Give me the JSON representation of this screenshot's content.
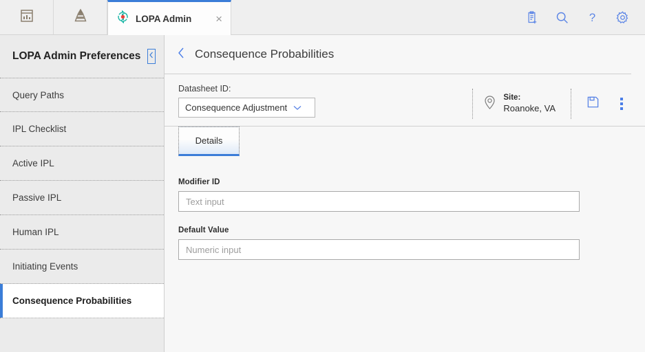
{
  "tabstrip": {
    "icon_tabs": [
      {
        "name": "dashboard-icon",
        "label": "Dashboard"
      },
      {
        "name": "pyramid-icon",
        "label": "Hierarchy"
      }
    ],
    "app_tab": {
      "label": "LOPA Admin",
      "icon": "refresh-circle-icon",
      "close_label": "×"
    },
    "actions": [
      {
        "name": "clipboard-add-icon",
        "label": "New Record"
      },
      {
        "name": "search-icon",
        "label": "Search"
      },
      {
        "name": "help-icon",
        "label": "Help"
      },
      {
        "name": "gear-icon",
        "label": "Settings"
      }
    ]
  },
  "sidebar": {
    "title": "LOPA Admin Preferences",
    "collapse_icon": "chevron-left-icon",
    "items": [
      {
        "label": "Query Paths",
        "active": false
      },
      {
        "label": "IPL Checklist",
        "active": false
      },
      {
        "label": "Active IPL",
        "active": false
      },
      {
        "label": "Passive IPL",
        "active": false
      },
      {
        "label": "Human IPL",
        "active": false
      },
      {
        "label": "Initiating Events",
        "active": false
      },
      {
        "label": "Consequence Probabilities",
        "active": true
      }
    ]
  },
  "page": {
    "back_icon": "chevron-left-icon",
    "title": "Consequence Probabilities"
  },
  "toolbar": {
    "datasheet_label": "Datasheet ID:",
    "datasheet_value": "Consequence Adjustment",
    "datasheet_chevron": "chevron-down-icon",
    "site_icon": "location-pin-icon",
    "site_label": "Site:",
    "site_value": "Roanoke, VA",
    "save_icon": "save-disk-icon",
    "overflow_icon": "kebab-menu-icon"
  },
  "tabs": [
    {
      "label": "Details",
      "active": true
    }
  ],
  "form": {
    "fields": [
      {
        "label": "Modifier ID",
        "placeholder": "Text input",
        "value": ""
      },
      {
        "label": "Default Value",
        "placeholder": "Numeric input",
        "value": ""
      }
    ]
  },
  "colors": {
    "accent": "#3b7dd8",
    "icon_blue": "#4a7ee8",
    "tab_icon": "#8a7f6e",
    "app_icon_teal": "#18b5a5",
    "app_icon_red": "#e8443c"
  }
}
